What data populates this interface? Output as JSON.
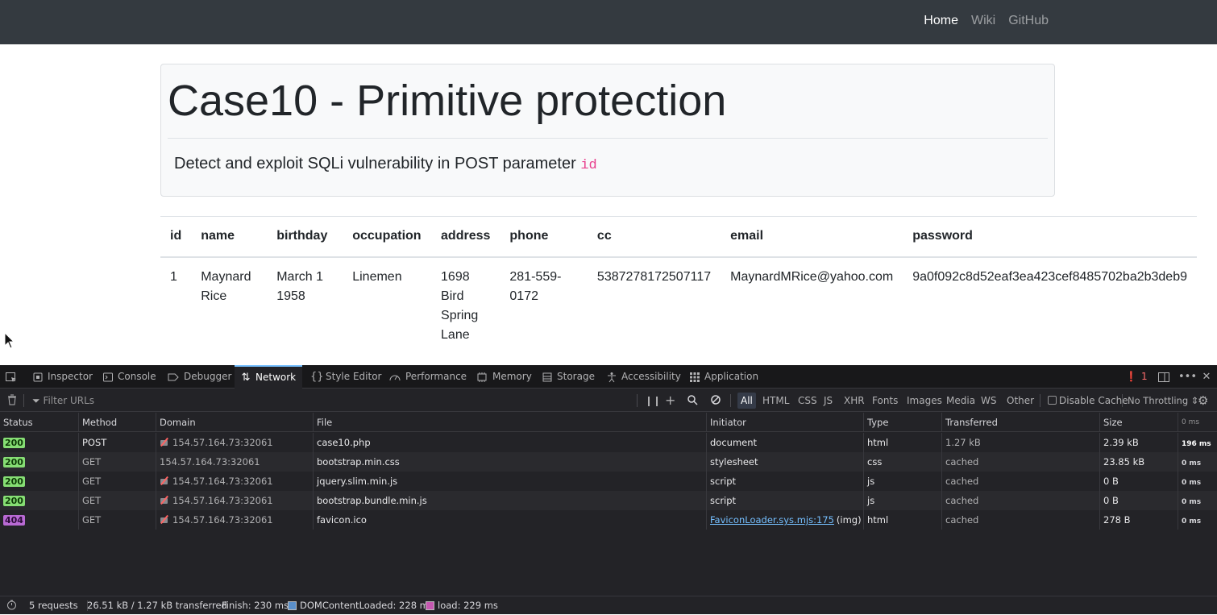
{
  "navbar": {
    "links": [
      {
        "label": "Home",
        "active": true
      },
      {
        "label": "Wiki",
        "active": false
      },
      {
        "label": "GitHub",
        "active": false
      }
    ]
  },
  "jumbotron": {
    "title": "Case10 - Primitive protection",
    "lead": "Detect and exploit SQLi vulnerability in POST parameter",
    "param": "id"
  },
  "table": {
    "headers": [
      "id",
      "name",
      "birthday",
      "occupation",
      "address",
      "phone",
      "cc",
      "email",
      "password"
    ],
    "rows": [
      {
        "id": "1",
        "name": "Maynard Rice",
        "birthday": "March 1 1958",
        "occupation": "Linemen",
        "address": "1698 Bird Spring Lane",
        "phone": "281-559-0172",
        "cc": "5387278172507117",
        "email": "MaynardMRice@yahoo.com",
        "password": "9a0f092c8d52eaf3ea423cef8485702ba2b3deb9"
      }
    ]
  },
  "devtools": {
    "tabs": [
      "Inspector",
      "Console",
      "Debugger",
      "Network",
      "Style Editor",
      "Performance",
      "Memory",
      "Storage",
      "Accessibility",
      "Application"
    ],
    "selected_tab": "Network",
    "error_count": "1",
    "toolbar": {
      "filter_placeholder": "Filter URLs",
      "type_filters": [
        "All",
        "HTML",
        "CSS",
        "JS",
        "XHR",
        "Fonts",
        "Images",
        "Media",
        "WS",
        "Other"
      ],
      "selected_filter": "All",
      "disable_cache_label": "Disable Cache",
      "throttling": "No Throttling"
    },
    "columns": [
      "Status",
      "Method",
      "Domain",
      "File",
      "Initiator",
      "Type",
      "Transferred",
      "Size",
      "0 ms"
    ],
    "requests": [
      {
        "status": "200",
        "method": "POST",
        "domain": "154.57.164.73:32061",
        "insecure": true,
        "file": "case10.php",
        "initiator": "document",
        "initiator_extra": "",
        "type": "html",
        "transferred": "1.27 kB",
        "size": "2.39 kB",
        "time": "196 ms"
      },
      {
        "status": "200",
        "method": "GET",
        "domain": "154.57.164.73:32061",
        "insecure": false,
        "file": "bootstrap.min.css",
        "initiator": "stylesheet",
        "initiator_extra": "",
        "type": "css",
        "transferred": "cached",
        "size": "23.85 kB",
        "time": "0 ms"
      },
      {
        "status": "200",
        "method": "GET",
        "domain": "154.57.164.73:32061",
        "insecure": true,
        "file": "jquery.slim.min.js",
        "initiator": "script",
        "initiator_extra": "",
        "type": "js",
        "transferred": "cached",
        "size": "0 B",
        "time": "0 ms"
      },
      {
        "status": "200",
        "method": "GET",
        "domain": "154.57.164.73:32061",
        "insecure": true,
        "file": "bootstrap.bundle.min.js",
        "initiator": "script",
        "initiator_extra": "",
        "type": "js",
        "transferred": "cached",
        "size": "0 B",
        "time": "0 ms"
      },
      {
        "status": "404",
        "method": "GET",
        "domain": "154.57.164.73:32061",
        "insecure": true,
        "file": "favicon.ico",
        "initiator": "FaviconLoader.sys.mjs:175",
        "initiator_extra": "(img)",
        "type": "html",
        "transferred": "cached",
        "size": "278 B",
        "time": "0 ms"
      }
    ],
    "footer": {
      "requests": "5 requests",
      "transferred": "26.51 kB / 1.27 kB transferred",
      "finish": "Finish: 230 ms",
      "dom_content_loaded": "DOMContentLoaded: 228 ms",
      "load": "load: 229 ms",
      "dcl_color": "#5a8fc9",
      "load_color": "#c558b0"
    }
  }
}
